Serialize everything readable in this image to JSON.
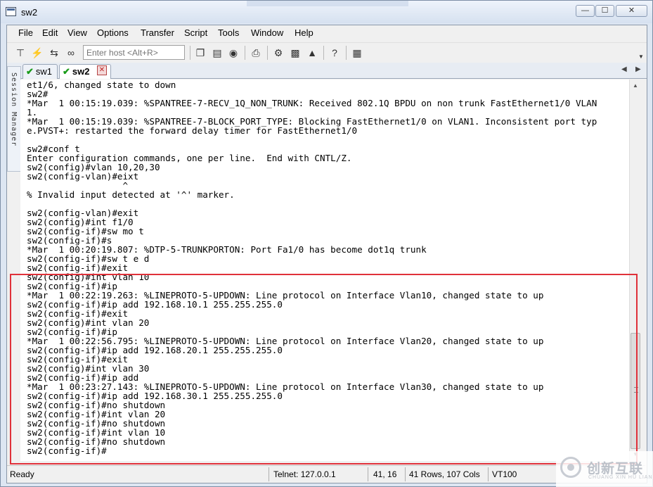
{
  "window": {
    "title": "sw2"
  },
  "menu": [
    "File",
    "Edit",
    "View",
    "Options",
    "Transfer",
    "Script",
    "Tools",
    "Window",
    "Help"
  ],
  "toolbar": {
    "host_placeholder": "Enter host <Alt+R>"
  },
  "tabs": [
    {
      "label": "sw1",
      "connected": true,
      "active": false
    },
    {
      "label": "sw2",
      "connected": true,
      "active": true
    }
  ],
  "session_manager_label": "Session Manager",
  "terminal": {
    "lines": [
      "et1/6, changed state to down",
      "sw2#",
      "*Mar  1 00:15:19.039: %SPANTREE-7-RECV_1Q_NON_TRUNK: Received 802.1Q BPDU on non trunk FastEthernet1/0 VLAN",
      "1.",
      "*Mar  1 00:15:19.039: %SPANTREE-7-BLOCK_PORT_TYPE: Blocking FastEthernet1/0 on VLAN1. Inconsistent port typ",
      "e.PVST+: restarted the forward delay timer for FastEthernet1/0",
      "",
      "sw2#conf t",
      "Enter configuration commands, one per line.  End with CNTL/Z.",
      "sw2(config)#vlan 10,20,30",
      "sw2(config-vlan)#eixt",
      "                  ^",
      "% Invalid input detected at '^' marker.",
      "",
      "sw2(config-vlan)#exit",
      "sw2(config)#int f1/0",
      "sw2(config-if)#sw mo t",
      "sw2(config-if)#s",
      "*Mar  1 00:20:19.807: %DTP-5-TRUNKPORTON: Port Fa1/0 has become dot1q trunk",
      "sw2(config-if)#sw t e d",
      "sw2(config-if)#exit",
      "sw2(config)#int vlan 10",
      "sw2(config-if)#ip",
      "*Mar  1 00:22:19.263: %LINEPROTO-5-UPDOWN: Line protocol on Interface Vlan10, changed state to up",
      "sw2(config-if)#ip add 192.168.10.1 255.255.255.0",
      "sw2(config-if)#exit",
      "sw2(config)#int vlan 20",
      "sw2(config-if)#ip",
      "*Mar  1 00:22:56.795: %LINEPROTO-5-UPDOWN: Line protocol on Interface Vlan20, changed state to up",
      "sw2(config-if)#ip add 192.168.20.1 255.255.255.0",
      "sw2(config-if)#exit",
      "sw2(config)#int vlan 30",
      "sw2(config-if)#ip add",
      "*Mar  1 00:23:27.143: %LINEPROTO-5-UPDOWN: Line protocol on Interface Vlan30, changed state to up",
      "sw2(config-if)#ip add 192.168.30.1 255.255.255.0",
      "sw2(config-if)#no shutdown",
      "sw2(config-if)#int vlan 20",
      "sw2(config-if)#no shutdown",
      "sw2(config-if)#int vlan 10",
      "sw2(config-if)#no shutdown",
      "sw2(config-if)#"
    ]
  },
  "status": {
    "ready": "Ready",
    "connection": "Telnet: 127.0.0.1",
    "cursor": "41,  16",
    "size": "41 Rows, 107 Cols",
    "emulation": "VT100"
  },
  "watermark": {
    "brand": "创新互联",
    "sub": "CHUANG XIN HU LIAN"
  },
  "colors": {
    "highlight_box": "#e0313a",
    "tab_check": "#1a9b1a"
  }
}
